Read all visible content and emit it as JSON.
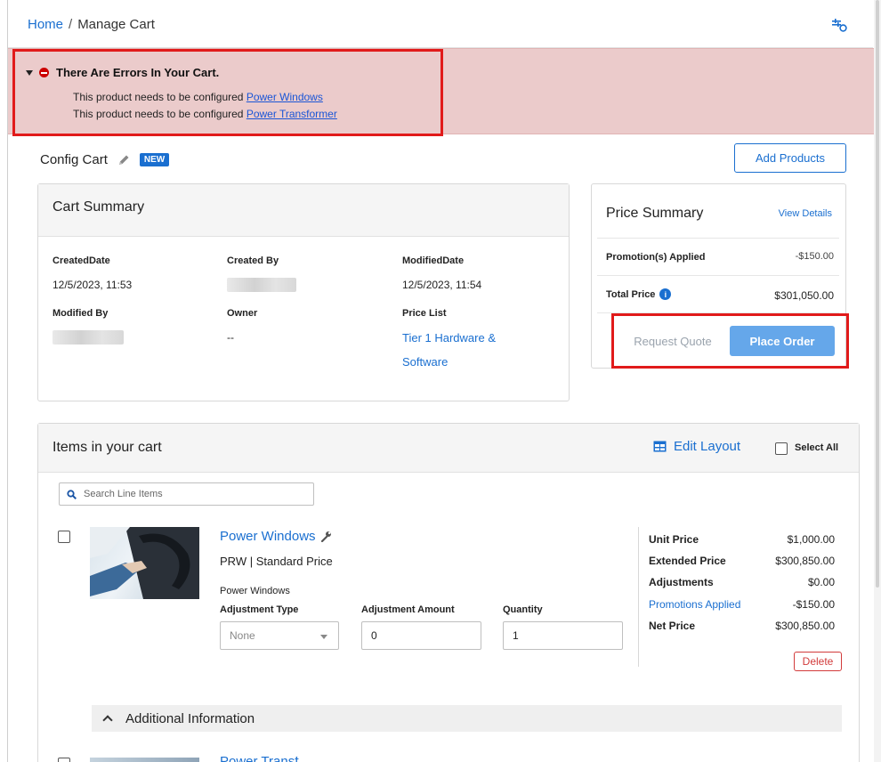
{
  "breadcrumb": {
    "home": "Home",
    "separator": "/",
    "current": "Manage Cart"
  },
  "errors": {
    "title": "There Are Errors In Your Cart.",
    "lines": [
      {
        "text": "This product needs to be configured",
        "link": "Power Windows"
      },
      {
        "text": "This product needs to be configured",
        "link": "Power Transformer"
      }
    ]
  },
  "cart": {
    "name": "Config Cart",
    "badge": "NEW",
    "add_products": "Add Products"
  },
  "cart_summary": {
    "title": "Cart Summary",
    "created_date_label": "CreatedDate",
    "created_date": "12/5/2023, 11:53",
    "created_by_label": "Created By",
    "modified_date_label": "ModifiedDate",
    "modified_date": "12/5/2023, 11:54",
    "modified_by_label": "Modified By",
    "owner_label": "Owner",
    "owner": "--",
    "price_list_label": "Price List",
    "price_list_line1": "Tier 1 Hardware &",
    "price_list_line2": "Software"
  },
  "price_summary": {
    "title": "Price Summary",
    "view_details": "View Details",
    "promotions_label": "Promotion(s) Applied",
    "promotions_value": "-$150.00",
    "total_label": "Total Price",
    "total_value": "$301,050.00",
    "request_quote": "Request Quote",
    "place_order": "Place Order"
  },
  "items": {
    "title": "Items in your cart",
    "edit_layout": "Edit Layout",
    "select_all": "Select All",
    "search_placeholder": "Search Line Items",
    "line": {
      "name": "Power Windows",
      "subtitle": "PRW | Standard Price",
      "description": "Power Windows",
      "adj_type_label": "Adjustment Type",
      "adj_type_value": "None",
      "adj_amount_label": "Adjustment Amount",
      "adj_amount_value": "0",
      "quantity_label": "Quantity",
      "quantity_value": "1",
      "unit_price_label": "Unit Price",
      "unit_price": "$1,000.00",
      "extended_price_label": "Extended Price",
      "extended_price": "$300,850.00",
      "adjustments_label": "Adjustments",
      "adjustments": "$0.00",
      "promotions_label": "Promotions Applied",
      "promotions": "-$150.00",
      "net_price_label": "Net Price",
      "net_price": "$300,850.00",
      "delete": "Delete"
    },
    "additional_info": "Additional Information",
    "next_line_name": "Power Transf..."
  },
  "colors": {
    "primary": "#1a6fd0",
    "error_bg": "#ebcbcb",
    "error_border": "#e11a1a",
    "place_order_bg": "#65a7ea",
    "delete": "#d23b3b"
  }
}
